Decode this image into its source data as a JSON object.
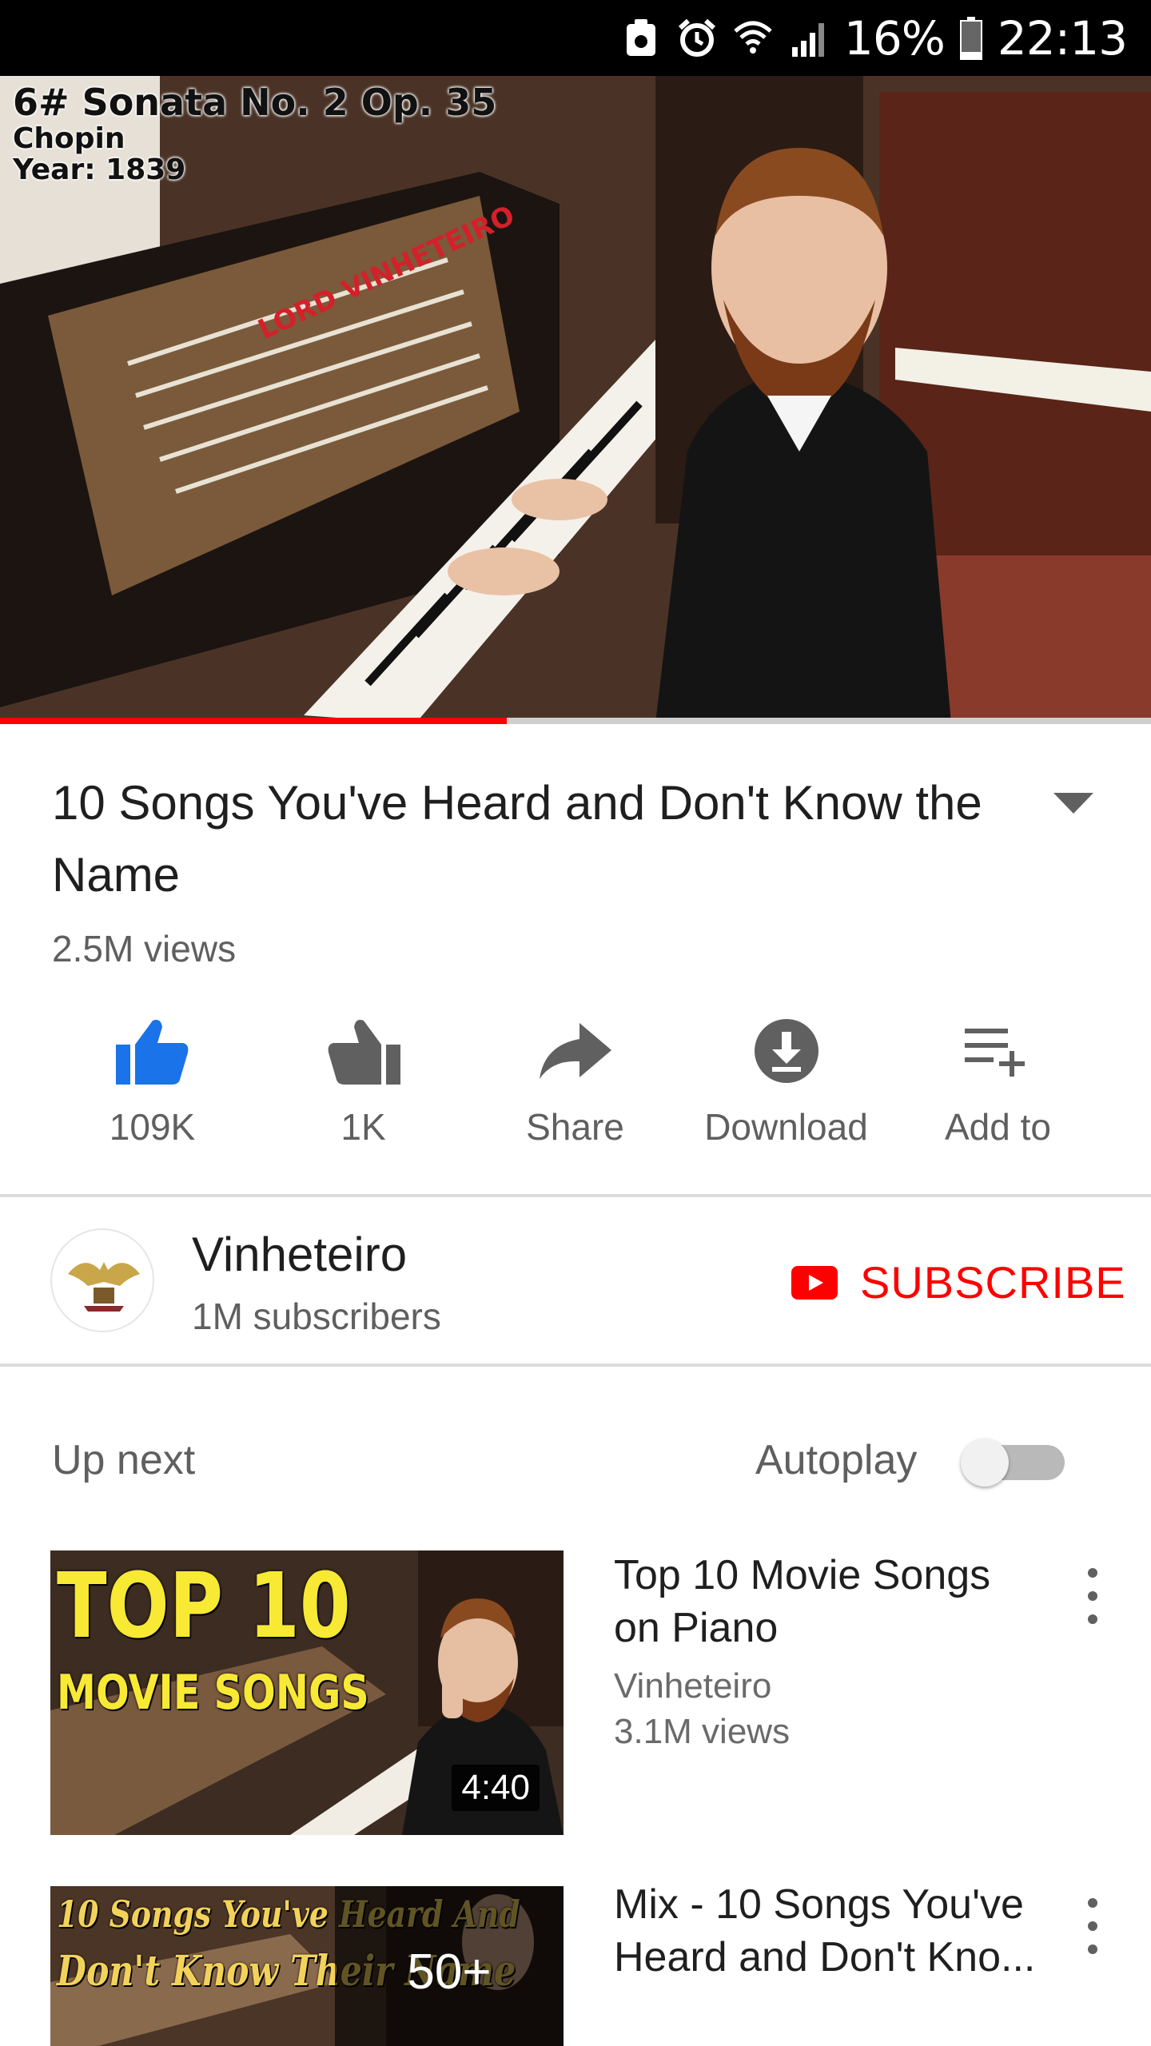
{
  "status_bar": {
    "battery_percent": "16%",
    "time": "22:13",
    "icons": [
      "screenshot-icon",
      "alarm-icon",
      "wifi-icon",
      "signal-icon",
      "battery-icon"
    ]
  },
  "player": {
    "overlay_line1": "6# Sonata No. 2 Op. 35",
    "overlay_line2": "Chopin",
    "overlay_line3": "Year: 1839",
    "progress": 0.44,
    "progress_color": "#ff0000"
  },
  "video": {
    "title": "10 Songs You've Heard and Don't Know the Name",
    "views": "2.5M views"
  },
  "actions": {
    "like_label": "109K",
    "dislike_label": "1K",
    "share_label": "Share",
    "download_label": "Download",
    "add_label": "Add to",
    "like_color": "#1a73e8"
  },
  "channel": {
    "name": "Vinheteiro",
    "subscribers": "1M subscribers",
    "subscribe_label": "SUBSCRIBE",
    "subscribe_color": "#ff0000"
  },
  "up_next": {
    "label": "Up next",
    "autoplay_label": "Autoplay",
    "autoplay_on": false
  },
  "recommendations": [
    {
      "title": "Top 10 Movie Songs on Piano",
      "channel": "Vinheteiro",
      "views": "3.1M views",
      "duration": "4:40",
      "thumb_line1": "TOP 10",
      "thumb_line2": "MOVIE SONGS"
    },
    {
      "title": "Mix - 10 Songs You've Heard and Don't Kno...",
      "thumb_line1": "10 Songs You've Heard And",
      "thumb_line2": "Don't Know Their Name",
      "playlist_count": "50+"
    }
  ]
}
